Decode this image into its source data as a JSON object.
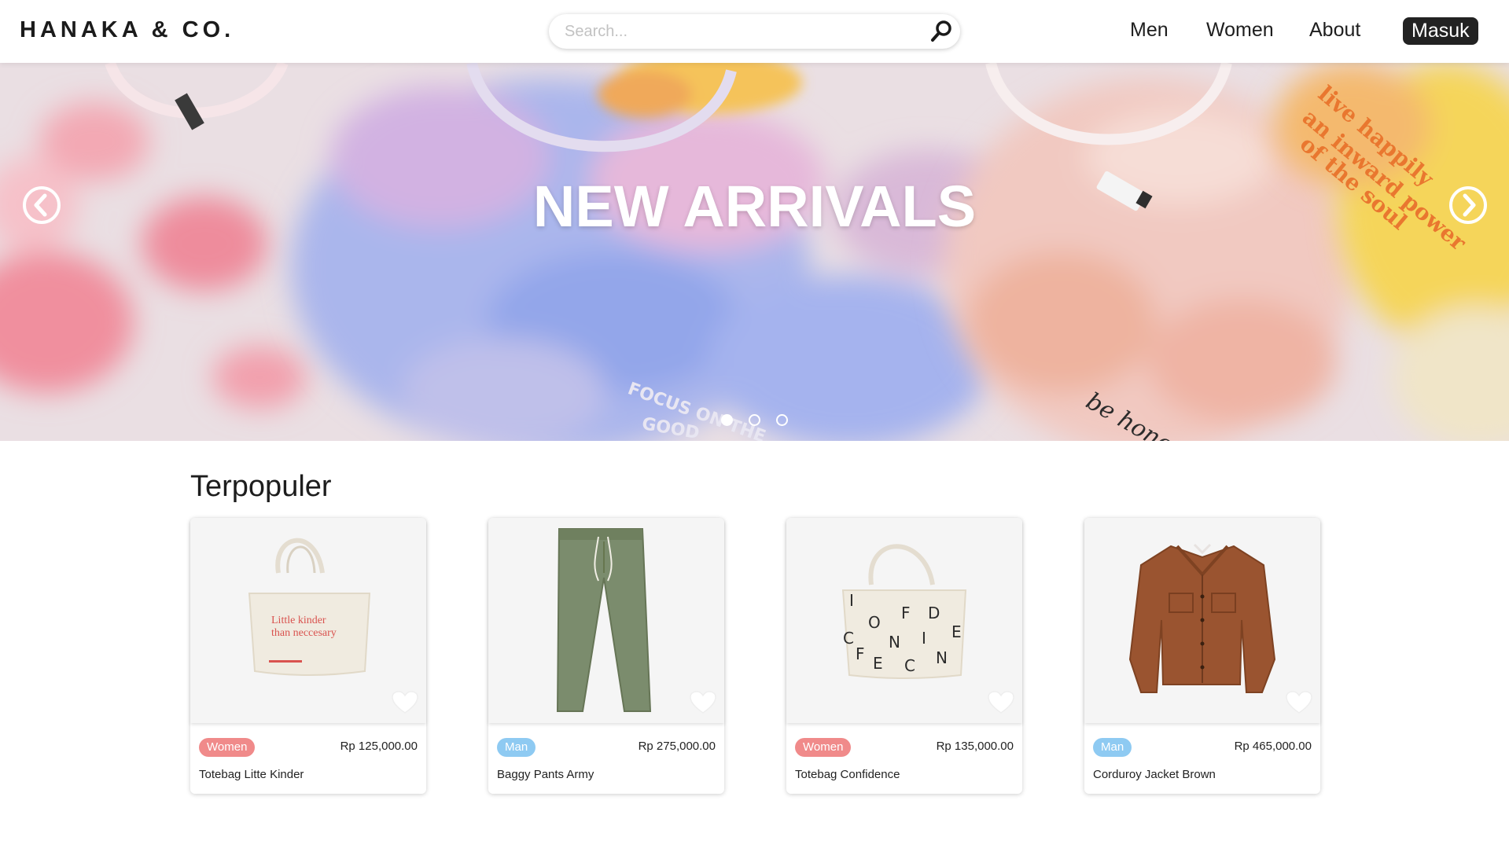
{
  "header": {
    "logo": "HANAKA & CO.",
    "search_placeholder": "Search...",
    "nav": {
      "men": "Men",
      "women": "Women",
      "about": "About"
    },
    "login_label": "Masuk"
  },
  "hero": {
    "title": "NEW ARRIVALS",
    "slides": 3,
    "active_slide": 1
  },
  "section": {
    "title": "Terpopuler"
  },
  "products": [
    {
      "category": "Women",
      "price": "Rp 125,000.00",
      "name": "Totebag Litte Kinder",
      "print_line1": "Little kinder",
      "print_line2": "than neccesary"
    },
    {
      "category": "Man",
      "price": "Rp 275,000.00",
      "name": "Baggy Pants Army"
    },
    {
      "category": "Women",
      "price": "Rp 135,000.00",
      "name": "Totebag Confidence"
    },
    {
      "category": "Man",
      "price": "Rp 465,000.00",
      "name": "Corduroy Jacket Brown"
    }
  ],
  "colors": {
    "women_badge": "#f08a8a",
    "man_badge": "#8ecaf2",
    "login_bg": "#222222"
  },
  "icons": {
    "search": "search-icon",
    "prev": "chevron-left-circle-icon",
    "next": "chevron-right-circle-icon",
    "favorite": "heart-icon"
  }
}
